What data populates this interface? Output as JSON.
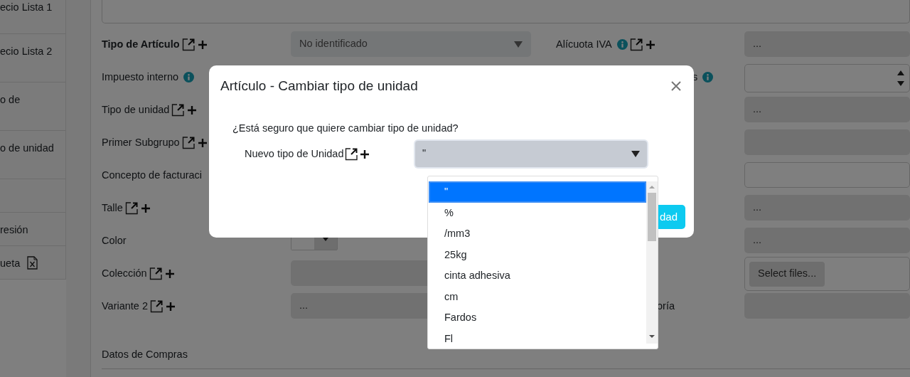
{
  "sidebar": {
    "items": [
      {
        "kind": "text",
        "label": "ecio Lista 1"
      },
      {
        "kind": "text",
        "label": "ecio Lista 2"
      },
      {
        "kind": "text",
        "label": "o de"
      },
      {
        "kind": "text",
        "label": "o de unidad"
      },
      {
        "kind": "blank"
      },
      {
        "kind": "text",
        "label": "resión"
      },
      {
        "kind": "export",
        "label": "ueta"
      }
    ]
  },
  "form": {
    "rows": [
      {
        "left": {
          "label": "Tipo de Artículo",
          "bold": true,
          "actions": true,
          "field": {
            "kind": "select",
            "value": "No identificado"
          }
        },
        "right": {
          "label": "Alícuota IVA",
          "info": true,
          "actions": true,
          "field": {
            "kind": "readonly",
            "value": "..."
          }
        }
      },
      {
        "left": {
          "label": "Impuesto interno",
          "info": true
        },
        "right": {
          "label": "s",
          "info": true,
          "field": {
            "kind": "number"
          }
        }
      },
      {
        "left": {
          "label": "Tipo de unidad",
          "actions": true
        },
        "right": {
          "field": {
            "kind": "readonly",
            "value": "..."
          }
        }
      },
      {
        "left": {
          "label": "Primer Subgrupo",
          "actions": true
        },
        "right": {
          "field": {
            "kind": "readonly"
          }
        }
      },
      {
        "left": {
          "label": "Concepto de facturaci"
        },
        "right": {
          "field": {
            "kind": "input"
          }
        }
      },
      {
        "left": {
          "label": "Talle",
          "actions": true
        },
        "right": {
          "field": {
            "kind": "readonly",
            "value": "..."
          }
        }
      },
      {
        "left": {
          "label": "Color",
          "field": {
            "kind": "color"
          }
        },
        "right": {
          "field": {
            "kind": "readonly",
            "value": "..."
          }
        }
      },
      {
        "left": {
          "label": "Colección",
          "actions": true,
          "field": {
            "kind": "readonly"
          }
        },
        "right": {
          "field": {
            "kind": "file",
            "button": "Select files..."
          }
        }
      },
      {
        "left": {
          "label": "Variante 2",
          "actions": true,
          "field": {
            "kind": "readonly",
            "value": "..."
          }
        },
        "right": {
          "label": "oría",
          "field": {
            "kind": "readonly"
          }
        }
      }
    ],
    "section": "Datos de Compras"
  },
  "dialog": {
    "title": "Artículo - Cambiar tipo de unidad",
    "message": "¿Está seguro que quiere cambiar tipo de unidad?",
    "field": {
      "label": "Nuevo tipo de Unidad",
      "actions": true,
      "value": "\"",
      "options": [
        {
          "label": "\"",
          "selected": true
        },
        {
          "label": "%",
          "selected": false
        },
        {
          "label": "/mm3",
          "selected": false
        },
        {
          "label": "25kg",
          "selected": false
        },
        {
          "label": "cinta adhesiva",
          "selected": false
        },
        {
          "label": "cm",
          "selected": false
        },
        {
          "label": "Fardos",
          "selected": false
        },
        {
          "label": "Fl",
          "selected": false
        }
      ]
    },
    "confirm_button": "dad"
  }
}
